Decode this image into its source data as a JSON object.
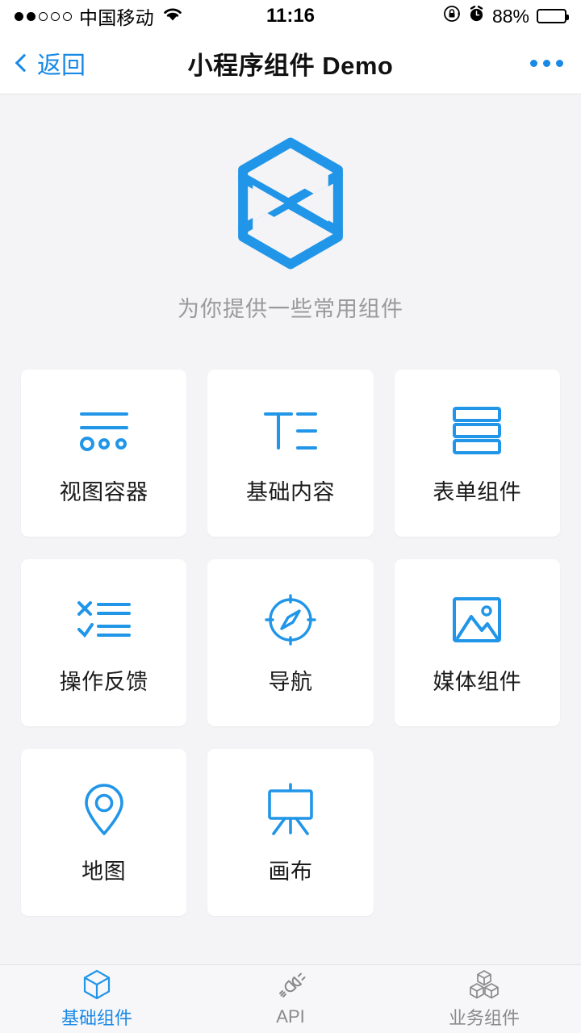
{
  "status_bar": {
    "signal_dots_filled": 2,
    "signal_dots_total": 5,
    "carrier": "中国移动",
    "wifi_icon": "wifi-icon",
    "time": "11:16",
    "rotation_lock_icon": "rotation-lock-icon",
    "alarm_icon": "alarm-clock-icon",
    "battery_text": "88%",
    "battery_percent": 88
  },
  "nav_bar": {
    "back_label": "返回",
    "back_icon": "chevron-left-icon",
    "title": "小程序组件 Demo",
    "more_icon": "more-dots-icon"
  },
  "hero": {
    "logo_icon": "hexagon-logo-icon",
    "subtitle": "为你提供一些常用组件"
  },
  "grid": {
    "cards": [
      {
        "label": "视图容器",
        "icon": "view-container-icon"
      },
      {
        "label": "基础内容",
        "icon": "basic-content-icon"
      },
      {
        "label": "表单组件",
        "icon": "form-components-icon"
      },
      {
        "label": "操作反馈",
        "icon": "action-feedback-icon"
      },
      {
        "label": "导航",
        "icon": "navigation-compass-icon"
      },
      {
        "label": "媒体组件",
        "icon": "media-image-icon"
      },
      {
        "label": "地图",
        "icon": "map-pin-icon"
      },
      {
        "label": "画布",
        "icon": "canvas-easel-icon"
      }
    ]
  },
  "tab_bar": {
    "tabs": [
      {
        "label": "基础组件",
        "icon": "cube-icon",
        "active": true
      },
      {
        "label": "API",
        "icon": "plug-connector-icon",
        "active": false
      },
      {
        "label": "业务组件",
        "icon": "cubes-stack-icon",
        "active": false
      }
    ]
  },
  "colors": {
    "accent": "#1989e6",
    "page_background": "#f4f4f6",
    "card_background": "#ffffff",
    "muted_text": "#9a9a9a",
    "tab_inactive": "#8a8a8a"
  }
}
